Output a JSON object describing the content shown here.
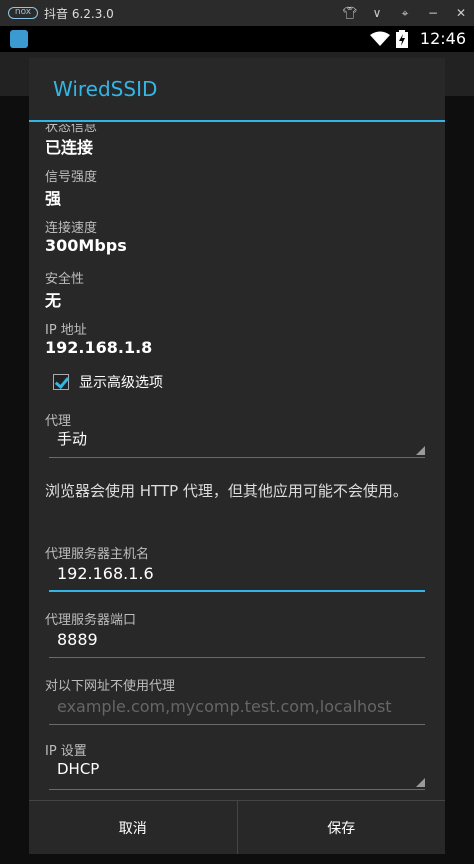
{
  "emulator": {
    "logo": "nox",
    "title": "抖音 6.2.3.0",
    "icons": [
      "shirt-icon",
      "chevron-down-icon",
      "pin-icon",
      "minimize-icon",
      "close-icon"
    ]
  },
  "status_bar": {
    "time": "12:46",
    "icons": [
      "wifi-icon",
      "battery-charging-icon"
    ]
  },
  "dialog": {
    "title": "WiredSSID",
    "status_label": "状态信息",
    "status_value": "已连接",
    "signal_label": "信号强度",
    "signal_value": "强",
    "speed_label": "连接速度",
    "speed_value": "300Mbps",
    "security_label": "安全性",
    "security_value": "无",
    "ip_label": "IP 地址",
    "ip_value": "192.168.1.8",
    "advanced_label": "显示高级选项",
    "advanced_checked": true,
    "proxy_label": "代理",
    "proxy_value": "手动",
    "proxy_note": "浏览器会使用 HTTP 代理，但其他应用可能不会使用。",
    "hostname_label": "代理服务器主机名",
    "hostname_value": "192.168.1.6",
    "port_label": "代理服务器端口",
    "port_value": "8889",
    "bypass_label": "对以下网址不使用代理",
    "bypass_placeholder": "example.com,mycomp.test.com,localhost",
    "ip_settings_label": "IP 设置",
    "ip_settings_value": "DHCP",
    "cancel_label": "取消",
    "save_label": "保存"
  },
  "colors": {
    "accent": "#33b5e5",
    "dialog_bg": "#282828"
  }
}
